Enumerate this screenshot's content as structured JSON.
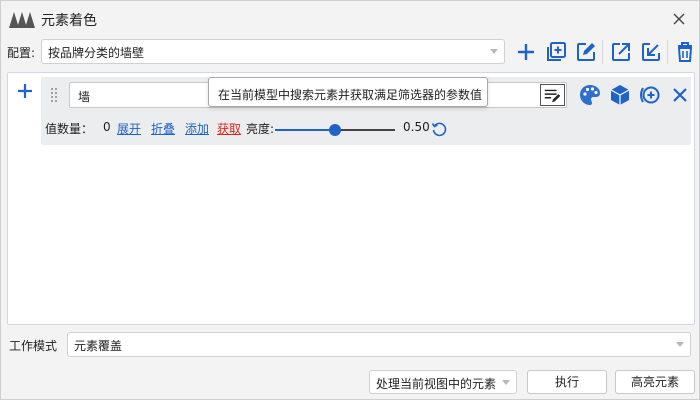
{
  "window": {
    "title": "元素着色"
  },
  "config": {
    "label": "配置:",
    "value": "按品牌分类的墙壁"
  },
  "toolbar": {
    "icons": [
      "plus-icon",
      "add-box-icon",
      "edit-icon",
      "export-icon",
      "import-icon",
      "trash-icon"
    ],
    "accent_color": "#1f63c9"
  },
  "rule": {
    "input_value": "墙",
    "count_label": "值数量：",
    "count_value": "0",
    "expand_label": "展开",
    "collapse_label": "折叠",
    "add_label": "添加",
    "fetch_label": "获取",
    "brightness_label": "亮度:",
    "brightness_value": "0.50",
    "brightness_level": 0.5,
    "tooltip": "在当前模型中搜索元素并获取满足筛选器的参数值"
  },
  "mode": {
    "label": "工作模式",
    "value": "元素覆盖"
  },
  "footer": {
    "scope_value": "处理当前视图中的元素",
    "execute_label": "执行",
    "highlight_label": "高亮元素"
  }
}
